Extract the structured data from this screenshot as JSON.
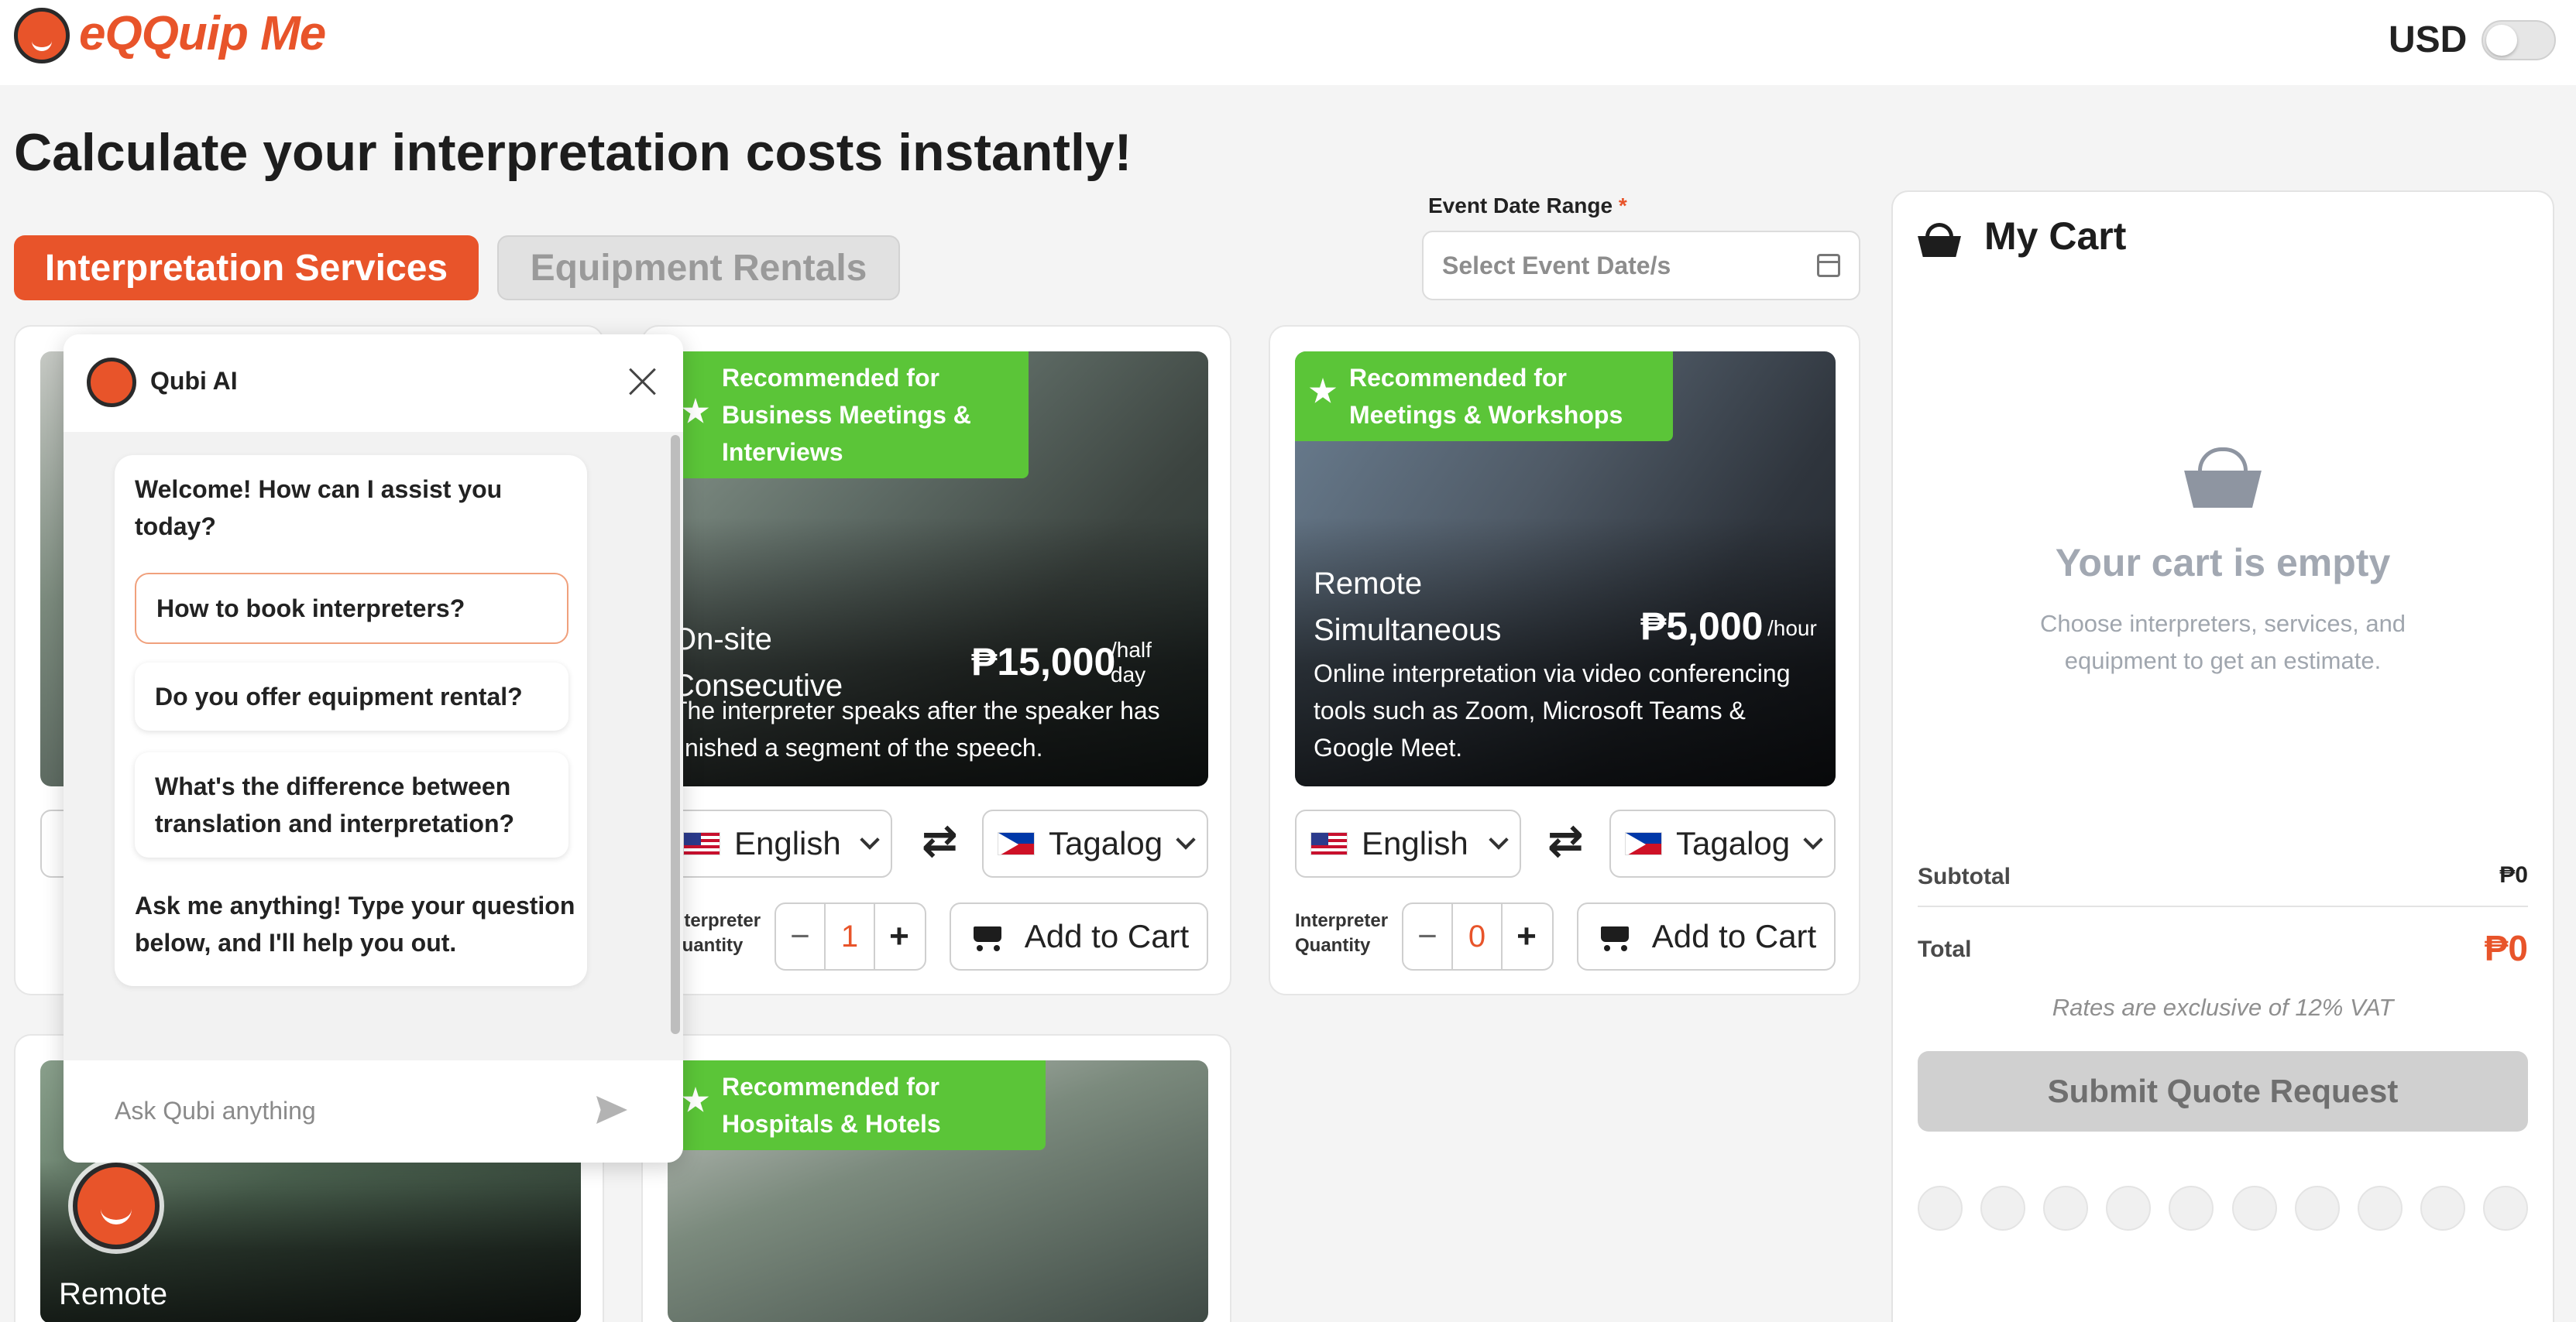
{
  "header": {
    "brand": "eQQuip Me",
    "currency": "USD"
  },
  "page_title": "Calculate your interpretation costs instantly!",
  "tabs": [
    {
      "label": "Interpretation Services",
      "active": true
    },
    {
      "label": "Equipment Rentals",
      "active": false
    }
  ],
  "date_range": {
    "label": "Event Date Range",
    "required_mark": "*",
    "placeholder": "Select Event Date/s"
  },
  "services": [
    {
      "badge": "Recommended for Business Meetings & Interviews",
      "title_line1": "On-site",
      "title_line2": "Consecutive",
      "price": "₱15,000",
      "unit": "/half day",
      "description": "The interpreter speaks after the speaker has finished a segment of the speech.",
      "source_lang": "English",
      "target_lang": "Tagalog",
      "quantity_label": "Interpreter Quantity",
      "quantity": "1",
      "add_label": "Add to Cart"
    },
    {
      "badge": "Recommended for Meetings & Workshops",
      "title_line1": "Remote",
      "title_line2": "Simultaneous",
      "price": "₱5,000",
      "unit": "/hour",
      "description": "Online interpretation via video conferencing tools such as Zoom, Microsoft Teams & Google Meet.",
      "source_lang": "English",
      "target_lang": "Tagalog",
      "quantity_label": "Interpreter Quantity",
      "quantity": "0",
      "add_label": "Add to Cart"
    },
    {
      "badge": "Recommended for Hospitals & Hotels"
    },
    {
      "title_line1": "Remote"
    }
  ],
  "cart": {
    "title": "My Cart",
    "empty_title": "Your cart is empty",
    "empty_sub": "Choose interpreters, services, and equipment to get an estimate.",
    "subtotal_label": "Subtotal",
    "subtotal_value": "₱0",
    "total_label": "Total",
    "total_value": "₱0",
    "vat_note": "Rates are exclusive of 12% VAT",
    "submit_label": "Submit Quote Request"
  },
  "chat": {
    "title": "Qubi AI",
    "welcome": "Welcome! How can I assist you today?",
    "suggestions": [
      "How to book interpreters?",
      "Do you offer equipment rental?",
      "What's the difference between translation and interpretation?"
    ],
    "prompt": "Ask me anything! Type your question below, and I'll help you out.",
    "input_placeholder": "Ask Qubi anything"
  },
  "colors": {
    "brand": "#e8542a",
    "badge_green": "#5bc538",
    "muted": "#a2a8b2"
  },
  "icons": [
    "calendar-icon",
    "star-icon",
    "swap-arrows-icon",
    "chevron-down-icon",
    "cart-icon",
    "basket-icon",
    "close-icon",
    "send-icon"
  ]
}
